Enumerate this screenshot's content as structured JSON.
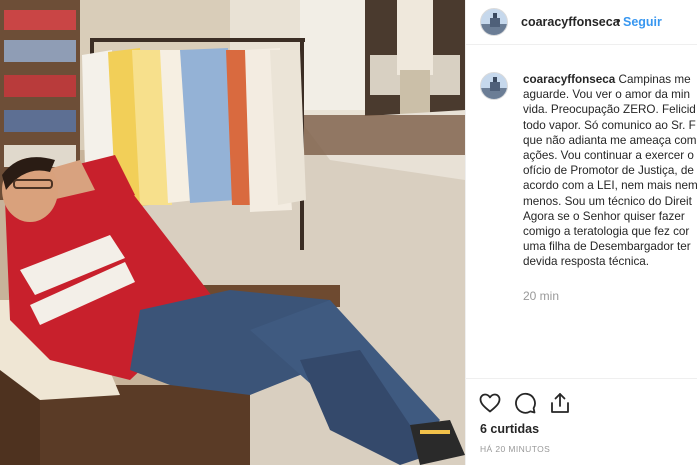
{
  "post": {
    "username": "coaracyffonseca",
    "follow_label": "Seguir",
    "header_separator": "•",
    "caption_lines": [
      "Campinas me",
      "aguarde. Vou ver o amor da min",
      "vida. Preocupação ZERO. Felicid",
      "todo vapor. Só comunico ao Sr. F",
      "que não adianta me ameaça com",
      "ações. Vou continuar a exercer o",
      "ofício de Promotor de Justiça, de",
      "acordo com a LEI, nem mais nem",
      "menos. Sou um técnico do Direit",
      "Agora se o Senhor quiser fazer",
      "comigo a teratologia que fez cor",
      "uma filha de Desembargador ter",
      "devida resposta técnica."
    ],
    "comment_time": "20 min",
    "likes_text": "6 curtidas",
    "posted_ago": "HÁ 20 MINUTOS"
  },
  "icons": {
    "like": "heart-icon",
    "comment": "comment-icon",
    "share": "share-icon"
  },
  "colors": {
    "accent": "#3897f0",
    "text": "#262626",
    "muted": "#999999",
    "divider": "#efefef"
  }
}
